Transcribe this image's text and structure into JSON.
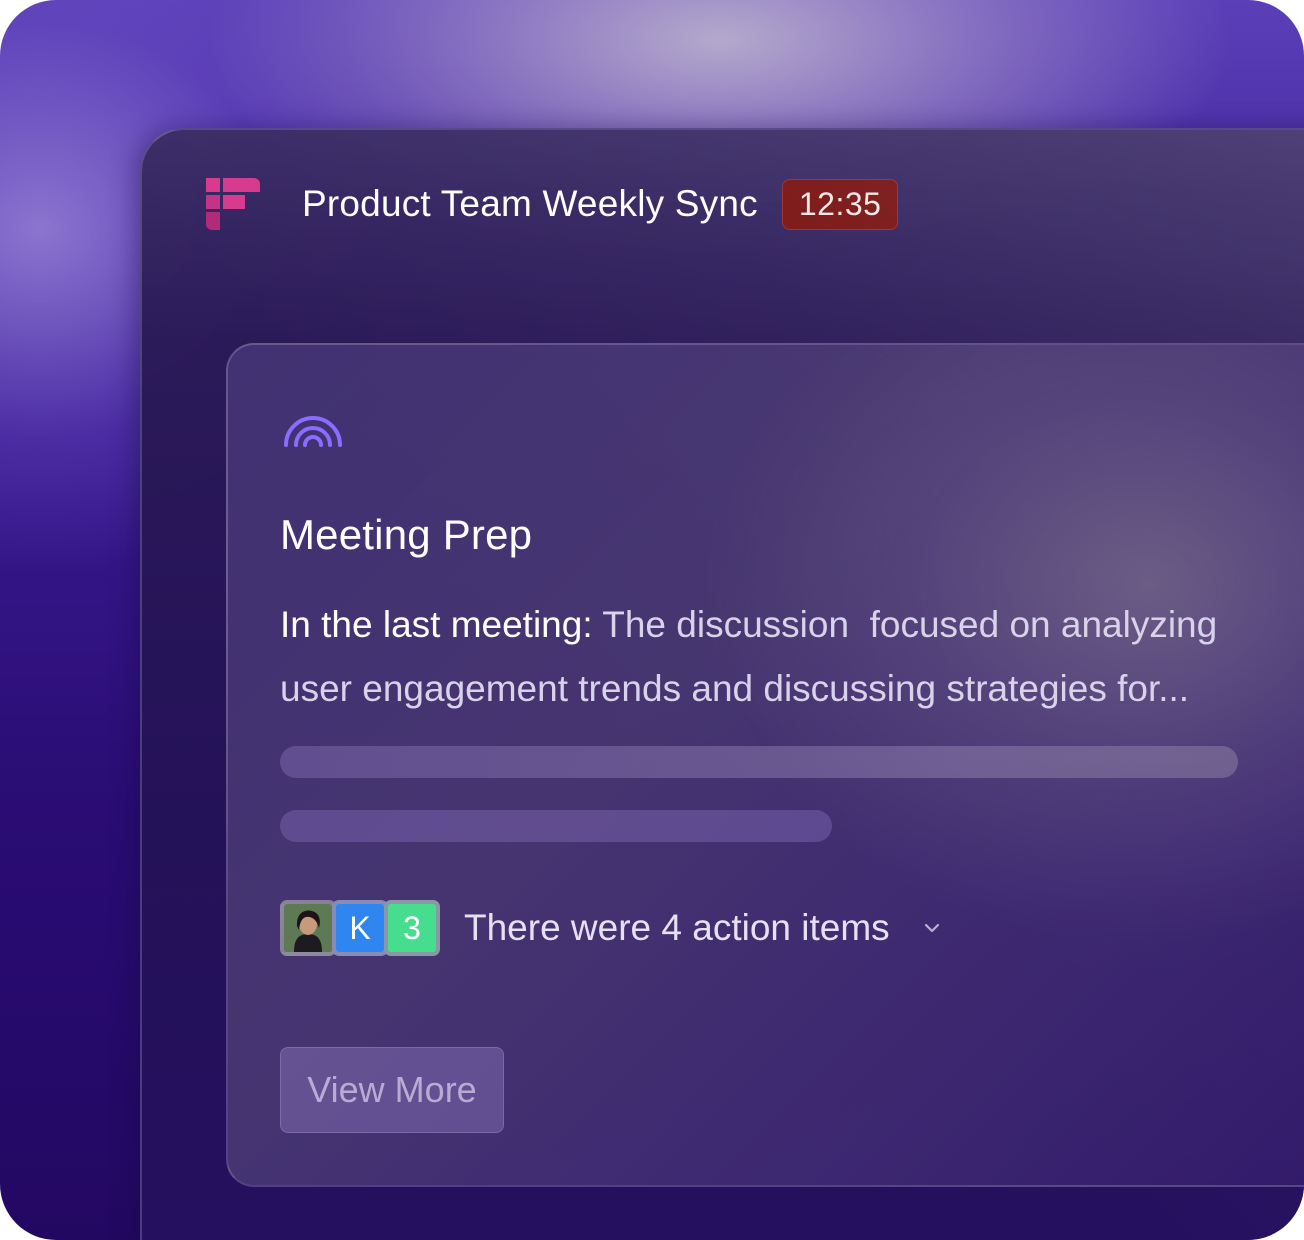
{
  "meeting": {
    "title": "Product Team Weekly Sync",
    "timer": "12:35"
  },
  "card": {
    "icon": "signal-icon",
    "title": "Meeting Prep",
    "summary_lead": "In the last meeting:",
    "summary_body": " The discussion  focused on analyzing user engagement trends and discussing strategies for...",
    "attendees": [
      {
        "type": "photo",
        "label": ""
      },
      {
        "type": "initial",
        "label": "K",
        "color": "#2f86f0"
      },
      {
        "type": "count",
        "label": "3",
        "color": "#47dd8f"
      }
    ],
    "action_items_text": "There were 4 action items",
    "view_more_label": "View More"
  },
  "colors": {
    "timer_bg": "#7a1414",
    "accent_icon": "#8a6cff",
    "logo_pink": "#d63a8c"
  }
}
